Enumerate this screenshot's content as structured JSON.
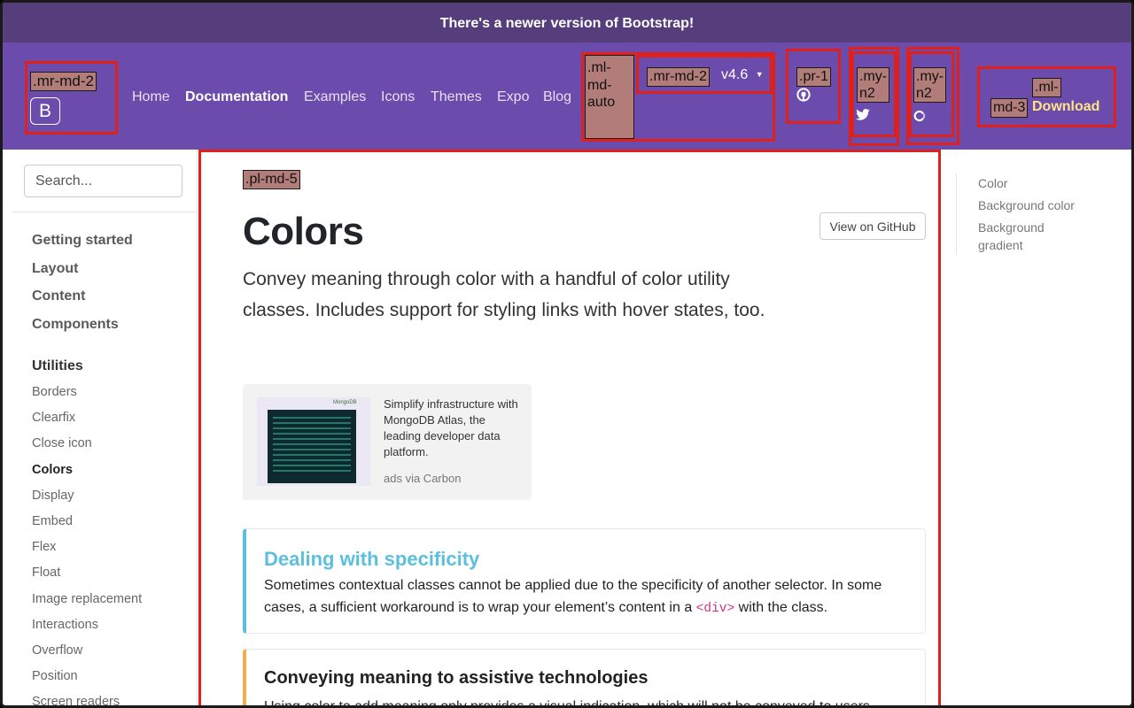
{
  "announcement": "There's a newer version of Bootstrap!",
  "navbar": {
    "brand_tag": ".mr-md-2",
    "brand_letter": "B",
    "links": [
      "Home",
      "Documentation",
      "Examples",
      "Icons",
      "Themes",
      "Expo",
      "Blog"
    ],
    "active_link": "Documentation",
    "ml_tag": [
      ".ml-",
      "md-",
      "auto"
    ],
    "version_tag": ".mr-md-2",
    "version": "v4.6",
    "github_tag": ".pr-1",
    "twitter_tag": [
      ".my-",
      "n2"
    ],
    "opencollective_tag": [
      ".my-",
      "n2"
    ],
    "download_tag": [
      ".ml-",
      "md-3"
    ],
    "download_label": "Download"
  },
  "sidebar": {
    "search_placeholder": "Search...",
    "sections": [
      "Getting started",
      "Layout",
      "Content",
      "Components"
    ],
    "current_section": "Utilities",
    "items": [
      "Borders",
      "Clearfix",
      "Close icon",
      "Colors",
      "Display",
      "Embed",
      "Flex",
      "Float",
      "Image replacement",
      "Interactions",
      "Overflow",
      "Position",
      "Screen readers"
    ],
    "active_item": "Colors"
  },
  "main": {
    "padding_tag": ".pl-md-5",
    "title": "Colors",
    "github_button": "View on GitHub",
    "lead": "Convey meaning through color with a handful of color utility classes. Includes support for styling links with hover states, too.",
    "ad": {
      "text": "Simplify infrastructure with MongoDB Atlas, the leading developer data platform.",
      "via": "ads via Carbon",
      "brand": "MongoDB"
    },
    "callouts": [
      {
        "title": "Dealing with specificity",
        "text_before": "Sometimes contextual classes cannot be applied due to the specificity of another selector. In some cases, a sufficient workaround is to wrap your element’s content in a ",
        "code": "<div>",
        "text_after": " with the class."
      },
      {
        "title": "Conveying meaning to assistive technologies",
        "text": "Using color to add meaning only provides a visual indication, which will not be conveyed to users"
      }
    ]
  },
  "toc": [
    "Color",
    "Background color",
    "Background gradient"
  ],
  "colors": {
    "announcement_bg": "#563d7c",
    "navbar_bg": "#6b4bab",
    "annotation_border": "#e0201a",
    "tag_bg": "#b27d78",
    "download": "#ffe484",
    "callout_info": "#5bc0de",
    "callout_warning": "#f0ad4e"
  }
}
